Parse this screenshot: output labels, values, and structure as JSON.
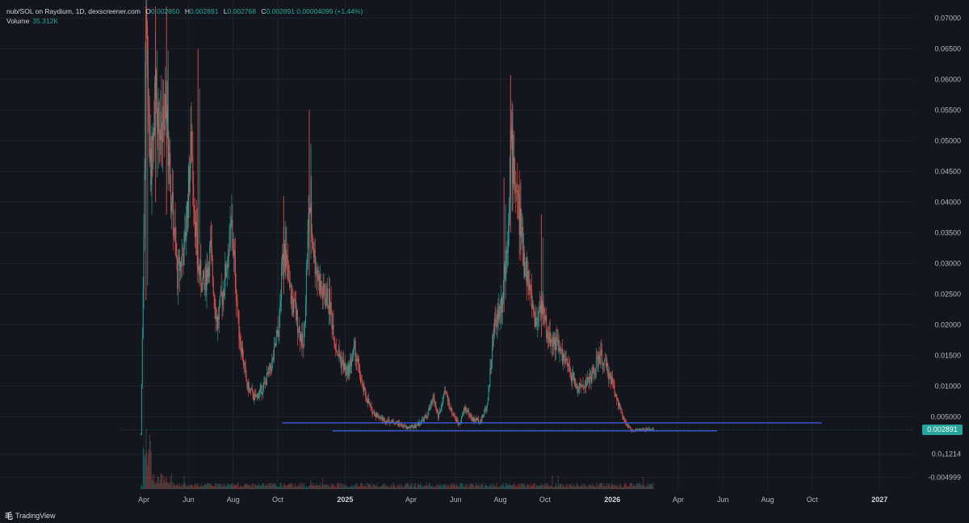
{
  "header": {
    "symbol": "nub/SOL on Raydium, 1D, dexscreener.com",
    "open_label": "O",
    "open": "0.002850",
    "high_label": "H",
    "high": "0.002891",
    "low_label": "L",
    "low": "0.002768",
    "close_label": "C",
    "close": "0.002891",
    "change": "0.00004099 (+1.44%)",
    "volume_label": "Volume",
    "volume": "35.312K"
  },
  "branding": {
    "name": "TradingView"
  },
  "current_price_label": "0.002891",
  "colors": {
    "background": "#14161d",
    "up": "#26a69a",
    "down": "#ef5350",
    "support_line": "#3b5bdb",
    "grid": "#1f222b"
  },
  "chart_data": {
    "type": "candlestick",
    "x_axis": {
      "range": [
        "2024-03-01",
        "2027-02-15"
      ],
      "ticks": [
        {
          "date": "2024-04-01",
          "label": "Apr"
        },
        {
          "date": "2024-06-01",
          "label": "Jun"
        },
        {
          "date": "2024-08-01",
          "label": "Aug"
        },
        {
          "date": "2024-10-01",
          "label": "Oct"
        },
        {
          "date": "2025-01-01",
          "label": "2025"
        },
        {
          "date": "2025-04-01",
          "label": "Apr"
        },
        {
          "date": "2025-06-01",
          "label": "Jun"
        },
        {
          "date": "2025-08-01",
          "label": "Aug"
        },
        {
          "date": "2025-10-01",
          "label": "Oct"
        },
        {
          "date": "2026-01-01",
          "label": "2026"
        },
        {
          "date": "2026-04-01",
          "label": "Apr"
        },
        {
          "date": "2026-06-01",
          "label": "Jun"
        },
        {
          "date": "2026-08-01",
          "label": "Aug"
        },
        {
          "date": "2026-10-01",
          "label": "Oct"
        },
        {
          "date": "2027-01-01",
          "label": "2027"
        }
      ]
    },
    "y_axis": {
      "range": [
        -0.0068,
        0.0719
      ],
      "ticks": [
        {
          "value": 0.07,
          "label": "0.07000"
        },
        {
          "value": 0.065,
          "label": "0.06500"
        },
        {
          "value": 0.06,
          "label": "0.06000"
        },
        {
          "value": 0.055,
          "label": "0.05500"
        },
        {
          "value": 0.05,
          "label": "0.05000"
        },
        {
          "value": 0.045,
          "label": "0.04500"
        },
        {
          "value": 0.04,
          "label": "0.04000"
        },
        {
          "value": 0.035,
          "label": "0.03500"
        },
        {
          "value": 0.03,
          "label": "0.03000"
        },
        {
          "value": 0.025,
          "label": "0.02500"
        },
        {
          "value": 0.02,
          "label": "0.02000"
        },
        {
          "value": 0.015,
          "label": "0.01500"
        },
        {
          "value": 0.01,
          "label": "0.01000"
        },
        {
          "value": 0.005,
          "label": "0.005000"
        },
        {
          "value": -0.0011,
          "label": "0.0₄1214"
        },
        {
          "value": -0.0049,
          "label": "-0.004999"
        }
      ]
    },
    "price_path": [
      {
        "date": "2024-03-28",
        "price": 0.002
      },
      {
        "date": "2024-03-31",
        "price": 0.027
      },
      {
        "date": "2024-04-04",
        "price": 0.068
      },
      {
        "date": "2024-04-10",
        "price": 0.045
      },
      {
        "date": "2024-04-17",
        "price": 0.058
      },
      {
        "date": "2024-04-25",
        "price": 0.05
      },
      {
        "date": "2024-05-02",
        "price": 0.054
      },
      {
        "date": "2024-05-09",
        "price": 0.04
      },
      {
        "date": "2024-05-17",
        "price": 0.028
      },
      {
        "date": "2024-05-27",
        "price": 0.033
      },
      {
        "date": "2024-06-05",
        "price": 0.05
      },
      {
        "date": "2024-06-13",
        "price": 0.03
      },
      {
        "date": "2024-06-22",
        "price": 0.026
      },
      {
        "date": "2024-07-01",
        "price": 0.032
      },
      {
        "date": "2024-07-10",
        "price": 0.02
      },
      {
        "date": "2024-07-20",
        "price": 0.027
      },
      {
        "date": "2024-07-30",
        "price": 0.036
      },
      {
        "date": "2024-08-09",
        "price": 0.019
      },
      {
        "date": "2024-08-20",
        "price": 0.01
      },
      {
        "date": "2024-08-31",
        "price": 0.008
      },
      {
        "date": "2024-09-12",
        "price": 0.01
      },
      {
        "date": "2024-09-24",
        "price": 0.014
      },
      {
        "date": "2024-10-03",
        "price": 0.02
      },
      {
        "date": "2024-10-09",
        "price": 0.035
      },
      {
        "date": "2024-10-16",
        "price": 0.026
      },
      {
        "date": "2024-10-27",
        "price": 0.021
      },
      {
        "date": "2024-11-05",
        "price": 0.016
      },
      {
        "date": "2024-11-13",
        "price": 0.04
      },
      {
        "date": "2024-11-20",
        "price": 0.031
      },
      {
        "date": "2024-11-30",
        "price": 0.025
      },
      {
        "date": "2024-12-10",
        "price": 0.024
      },
      {
        "date": "2024-12-20",
        "price": 0.016
      },
      {
        "date": "2025-01-04",
        "price": 0.012
      },
      {
        "date": "2025-01-14",
        "price": 0.016
      },
      {
        "date": "2025-01-24",
        "price": 0.01
      },
      {
        "date": "2025-02-06",
        "price": 0.006
      },
      {
        "date": "2025-02-22",
        "price": 0.0045
      },
      {
        "date": "2025-03-12",
        "price": 0.004
      },
      {
        "date": "2025-03-26",
        "price": 0.0032
      },
      {
        "date": "2025-04-07",
        "price": 0.0035
      },
      {
        "date": "2025-04-22",
        "price": 0.005
      },
      {
        "date": "2025-05-02",
        "price": 0.008
      },
      {
        "date": "2025-05-08",
        "price": 0.005
      },
      {
        "date": "2025-05-18",
        "price": 0.009
      },
      {
        "date": "2025-05-26",
        "price": 0.006
      },
      {
        "date": "2025-06-05",
        "price": 0.0038
      },
      {
        "date": "2025-06-14",
        "price": 0.0065
      },
      {
        "date": "2025-06-24",
        "price": 0.0045
      },
      {
        "date": "2025-07-06",
        "price": 0.0045
      },
      {
        "date": "2025-07-14",
        "price": 0.007
      },
      {
        "date": "2025-07-24",
        "price": 0.02
      },
      {
        "date": "2025-08-03",
        "price": 0.024
      },
      {
        "date": "2025-08-11",
        "price": 0.035
      },
      {
        "date": "2025-08-15",
        "price": 0.05
      },
      {
        "date": "2025-08-23",
        "price": 0.042
      },
      {
        "date": "2025-09-01",
        "price": 0.032
      },
      {
        "date": "2025-09-11",
        "price": 0.025
      },
      {
        "date": "2025-09-19",
        "price": 0.02
      },
      {
        "date": "2025-09-25",
        "price": 0.024
      },
      {
        "date": "2025-10-05",
        "price": 0.018
      },
      {
        "date": "2025-10-17",
        "price": 0.017
      },
      {
        "date": "2025-11-01",
        "price": 0.013
      },
      {
        "date": "2025-11-15",
        "price": 0.0095
      },
      {
        "date": "2025-12-01",
        "price": 0.011
      },
      {
        "date": "2025-12-16",
        "price": 0.015
      },
      {
        "date": "2025-12-31",
        "price": 0.011
      },
      {
        "date": "2026-01-16",
        "price": 0.0045
      },
      {
        "date": "2026-01-26",
        "price": 0.0028
      },
      {
        "date": "2026-02-10",
        "price": 0.0029
      },
      {
        "date": "2026-02-26",
        "price": 0.00289
      }
    ],
    "spikes": [
      {
        "date": "2024-04-04",
        "low": 0.024,
        "high": 0.0719
      },
      {
        "date": "2024-04-17",
        "low": 0.04,
        "high": 0.0719
      },
      {
        "date": "2024-05-02",
        "low": 0.038,
        "high": 0.0719
      },
      {
        "date": "2024-06-14",
        "low": 0.03,
        "high": 0.065
      },
      {
        "date": "2024-11-13",
        "low": 0.028,
        "high": 0.055
      },
      {
        "date": "2024-10-09",
        "low": 0.025,
        "high": 0.041
      },
      {
        "date": "2025-08-15",
        "low": 0.035,
        "high": 0.0607
      },
      {
        "date": "2025-09-26",
        "low": 0.018,
        "high": 0.038
      },
      {
        "date": "2025-08-06",
        "low": 0.022,
        "high": 0.044
      }
    ],
    "support_lines": [
      {
        "price": 0.004,
        "from": "2024-10-07",
        "to": "2026-10-14"
      },
      {
        "price": 0.0027,
        "from": "2024-12-15",
        "to": "2026-05-24"
      }
    ],
    "volume_profile": "low volume throughout; spike near launch in early April 2024"
  }
}
